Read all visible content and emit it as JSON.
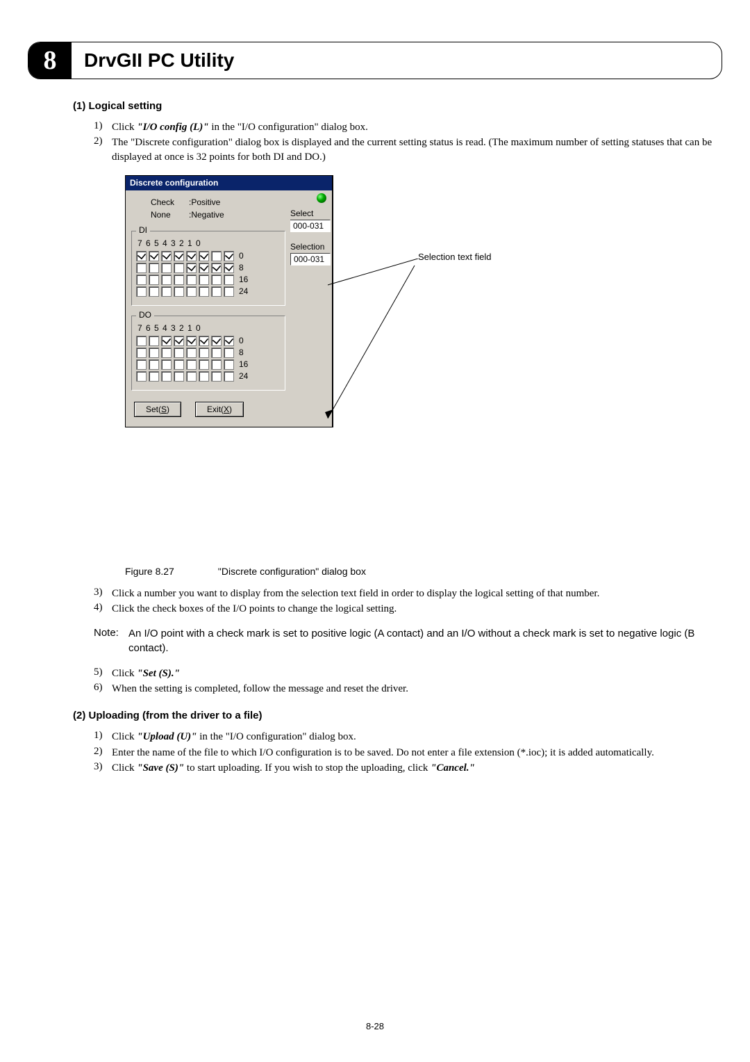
{
  "chapter": {
    "number": "8",
    "title": "DrvGII PC Utility"
  },
  "sectionA": {
    "head": "(1)  Logical setting",
    "steps": [
      {
        "n": "1)",
        "pre": "Click ",
        "cmd": "\"I/O config (L)\"",
        "post": " in the \"I/O configuration\" dialog box."
      },
      {
        "n": "2)",
        "pre": "The \"Discrete configuration\" dialog box is displayed and the current setting status is read. (The maximum number of setting statuses that can be displayed at once is 32 points for both DI and DO.)",
        "cmd": "",
        "post": ""
      }
    ],
    "steps2": [
      {
        "n": "3)",
        "pre": "Click a number you want to display from the selection text field in order to display the logical setting of that number.",
        "cmd": "",
        "post": ""
      },
      {
        "n": "4)",
        "pre": "Click the check boxes of the I/O points to change the logical setting.",
        "cmd": "",
        "post": ""
      }
    ],
    "note": {
      "label": "Note:",
      "text": "An I/O point with a check mark is set to positive logic (A contact) and an I/O without a check mark is set to negative logic (B contact)."
    },
    "steps3": [
      {
        "n": "5)",
        "pre": "Click ",
        "cmd": "\"Set (S).\"",
        "post": ""
      },
      {
        "n": "6)",
        "pre": "When the setting is completed, follow the message and reset the driver.",
        "cmd": "",
        "post": ""
      }
    ]
  },
  "dialog": {
    "title": "Discrete configuration",
    "legend": [
      [
        "Check",
        ":Positive"
      ],
      [
        "None",
        ":Negative"
      ]
    ],
    "selectLabel": "Select",
    "selectValue": "000-031",
    "selectionLabel": "Selection",
    "selectionValue": "000-031",
    "di": {
      "label": "DI",
      "bits": "7 6 5 4 3 2 1 0",
      "rows": [
        {
          "checks": [
            true,
            true,
            true,
            true,
            true,
            true,
            false,
            true
          ],
          "suffix": "0"
        },
        {
          "checks": [
            false,
            false,
            false,
            false,
            true,
            true,
            true,
            true
          ],
          "suffix": "8"
        },
        {
          "checks": [
            false,
            false,
            false,
            false,
            false,
            false,
            false,
            false
          ],
          "suffix": "16"
        },
        {
          "checks": [
            false,
            false,
            false,
            false,
            false,
            false,
            false,
            false
          ],
          "suffix": "24"
        }
      ]
    },
    "do": {
      "label": "DO",
      "bits": "7 6 5 4 3 2 1 0",
      "rows": [
        {
          "checks": [
            false,
            false,
            true,
            true,
            true,
            true,
            true,
            true
          ],
          "suffix": "0"
        },
        {
          "checks": [
            false,
            false,
            false,
            false,
            false,
            false,
            false,
            false
          ],
          "suffix": "8"
        },
        {
          "checks": [
            false,
            false,
            false,
            false,
            false,
            false,
            false,
            false
          ],
          "suffix": "16"
        },
        {
          "checks": [
            false,
            false,
            false,
            false,
            false,
            false,
            false,
            false
          ],
          "suffix": "24"
        }
      ]
    },
    "setBtnPre": "Set(",
    "setBtnKey": "S",
    "setBtnPost": ")",
    "exitBtnPre": "Exit(",
    "exitBtnKey": "X",
    "exitBtnPost": ")"
  },
  "callout": "Selection text field",
  "figure": {
    "id": "Figure 8.27",
    "caption": "\"Discrete configuration\" dialog box"
  },
  "sectionB": {
    "head": "(2)  Uploading (from the driver to a file)",
    "steps": [
      {
        "n": "1)",
        "pre": "Click ",
        "cmd": "\"Upload (U)\"",
        "post": " in the \"I/O configuration\" dialog box."
      },
      {
        "n": "2)",
        "pre": "Enter the name of the file to which I/O configuration is to be saved. Do not enter a file extension (*.ioc); it is added automatically.",
        "cmd": "",
        "post": ""
      },
      {
        "n": "3)",
        "pre": "Click ",
        "cmd": "\"Save (S)\"",
        "post": " to start uploading. If you wish to stop the uploading, click ",
        "cmd2": "\"Cancel.\""
      }
    ]
  },
  "pageNumber": "8-28"
}
